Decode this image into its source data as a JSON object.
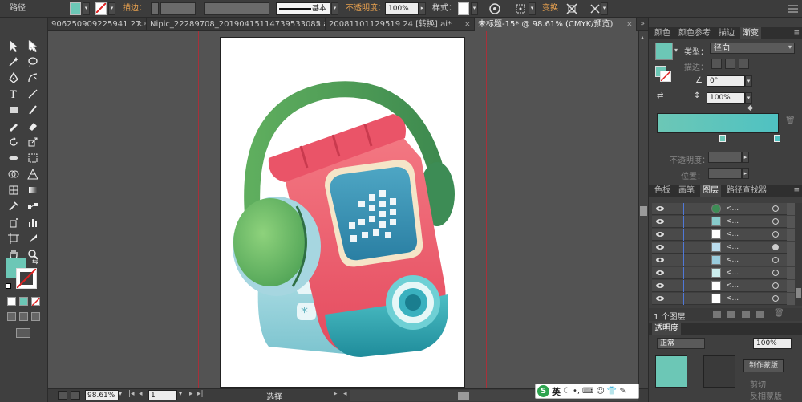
{
  "control_bar": {
    "object_type": "路径",
    "stroke_label": "描边：",
    "brush_definition": "基本",
    "opacity_label": "不透明度：",
    "opacity_value": "100%",
    "style_label": "样式：",
    "transform_label": "变换",
    "fill_color": "#6cc7b6"
  },
  "tabs": [
    {
      "label": "906250909225941 27.ai*",
      "close": "×"
    },
    {
      "label": "Nipic_22289708_20190415114739533085.ai*",
      "close": "×"
    },
    {
      "label": "20081101129519 24 [转换].ai*",
      "close": "×"
    },
    {
      "label": "未标题-15* @ 98.61% (CMYK/预览)",
      "close": "×"
    }
  ],
  "panels": {
    "top_tabs": [
      "颜色",
      "颜色参考",
      "描边",
      "渐变"
    ],
    "gradient": {
      "type_label": "类型：",
      "type_value": "径向",
      "stroke_label": "描边：",
      "angle_value": "0°",
      "aspect_value": "100%",
      "opacity_label": "不透明度：",
      "position_label": "位置：",
      "start_color": "#6cc7b6",
      "end_color": "#4fc2c2"
    },
    "layer_tabs": [
      "色板",
      "画笔",
      "图层",
      "路径查找器"
    ],
    "layers": [
      {
        "name": "<..."
      },
      {
        "name": "<..."
      },
      {
        "name": "<..."
      },
      {
        "name": "<..."
      },
      {
        "name": "<..."
      },
      {
        "name": "<..."
      },
      {
        "name": "<..."
      },
      {
        "name": "<..."
      }
    ],
    "layer_count": "1 个图层",
    "transparency_label": "透明度",
    "transparency_mode": "正常",
    "transparency_value": "100%",
    "make_mask": "制作蒙版",
    "clip_label": "剪切",
    "invert_label": "反相蒙版"
  },
  "status": {
    "zoom": "98.61%",
    "page": "1",
    "tool_name": "选择"
  },
  "ime": {
    "logo": "S",
    "lang": "英"
  }
}
